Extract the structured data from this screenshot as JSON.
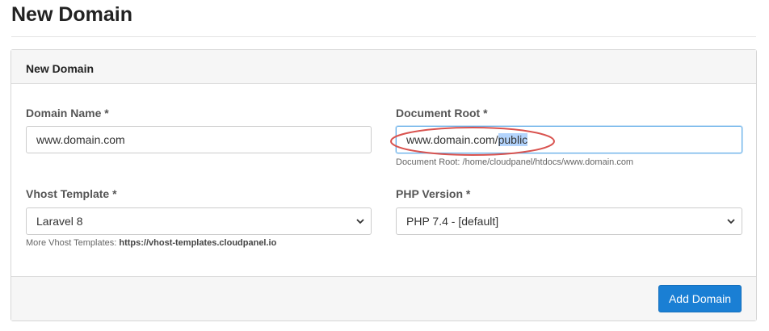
{
  "page": {
    "title": "New Domain"
  },
  "card": {
    "header_title": "New Domain",
    "domain_name": {
      "label": "Domain Name *",
      "value": "www.domain.com"
    },
    "document_root": {
      "label": "Document Root *",
      "value_prefix": "www.domain.com/",
      "value_selected": "public",
      "help": "Document Root: /home/cloudpanel/htdocs/www.domain.com"
    },
    "vhost_template": {
      "label": "Vhost Template *",
      "selected": "Laravel 8",
      "help_prefix": "More Vhost Templates: ",
      "help_link": "https://vhost-templates.cloudpanel.io"
    },
    "php_version": {
      "label": "PHP Version *",
      "selected": "PHP 7.4 - [default]"
    },
    "submit_label": "Add Domain"
  },
  "annotation": {
    "color": "#d9534f",
    "target": "document-root-input"
  },
  "colors": {
    "primary": "#1a7fd4",
    "selection": "#b3d4fd",
    "header_bg": "#f6f6f6"
  }
}
